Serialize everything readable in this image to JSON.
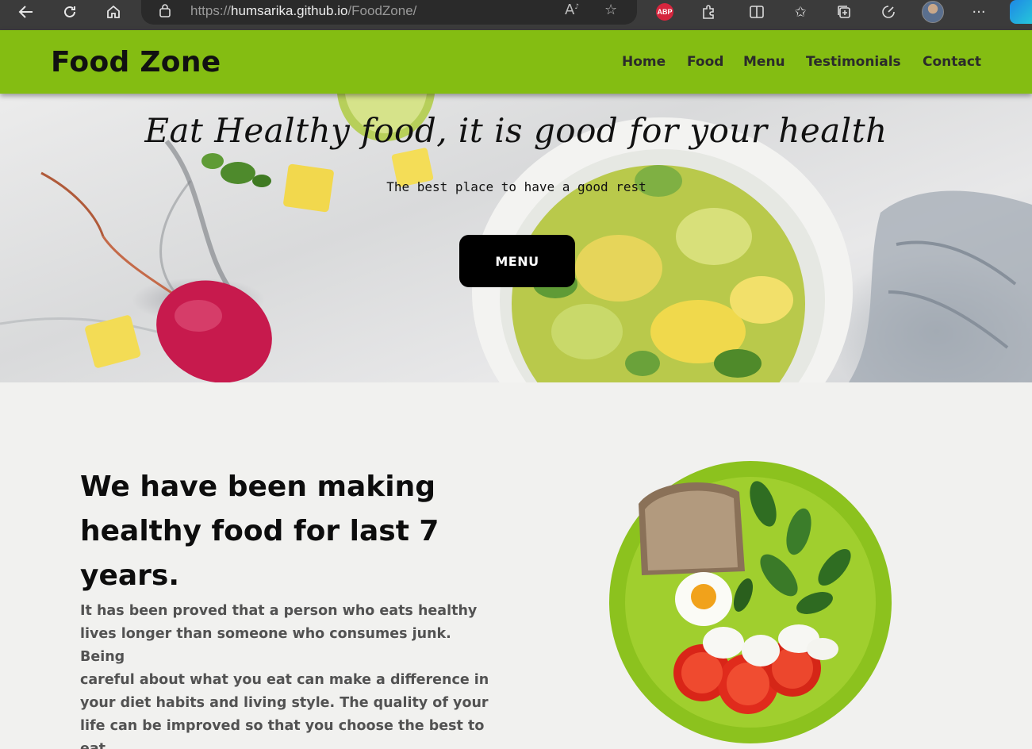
{
  "browser": {
    "url_scheme": "https://",
    "url_host": "humsarika.github.io",
    "url_path": "/FoodZone/",
    "adblock_badge": "ABP"
  },
  "site": {
    "logo": "Food Zone",
    "nav": [
      "Home",
      "Food",
      "Menu",
      "Testimonials",
      "Contact"
    ],
    "accent_color": "#84bd12"
  },
  "hero": {
    "title": "Eat Healthy food, it is good for your health",
    "subtitle": "The best place to have a good rest",
    "button_label": "MENU"
  },
  "about": {
    "heading_lines": [
      "We have been making",
      "healthy food for last 7",
      "years."
    ],
    "paragraph_lines": [
      "It has been proved that a person who eats healthy",
      "lives longer than someone who consumes junk. Being",
      "careful about what you eat can make a difference in",
      "your diet habits and living style. The quality of your",
      "life can be improved so that you choose the best to",
      "eat."
    ]
  },
  "icons": [
    "back-icon",
    "refresh-icon",
    "home-icon",
    "lock-icon",
    "read-aloud-icon",
    "favorite-star-icon",
    "extensions-icon",
    "split-screen-icon",
    "favorites-icon",
    "collections-icon",
    "performance-icon",
    "more-icon",
    "bing-icon"
  ]
}
